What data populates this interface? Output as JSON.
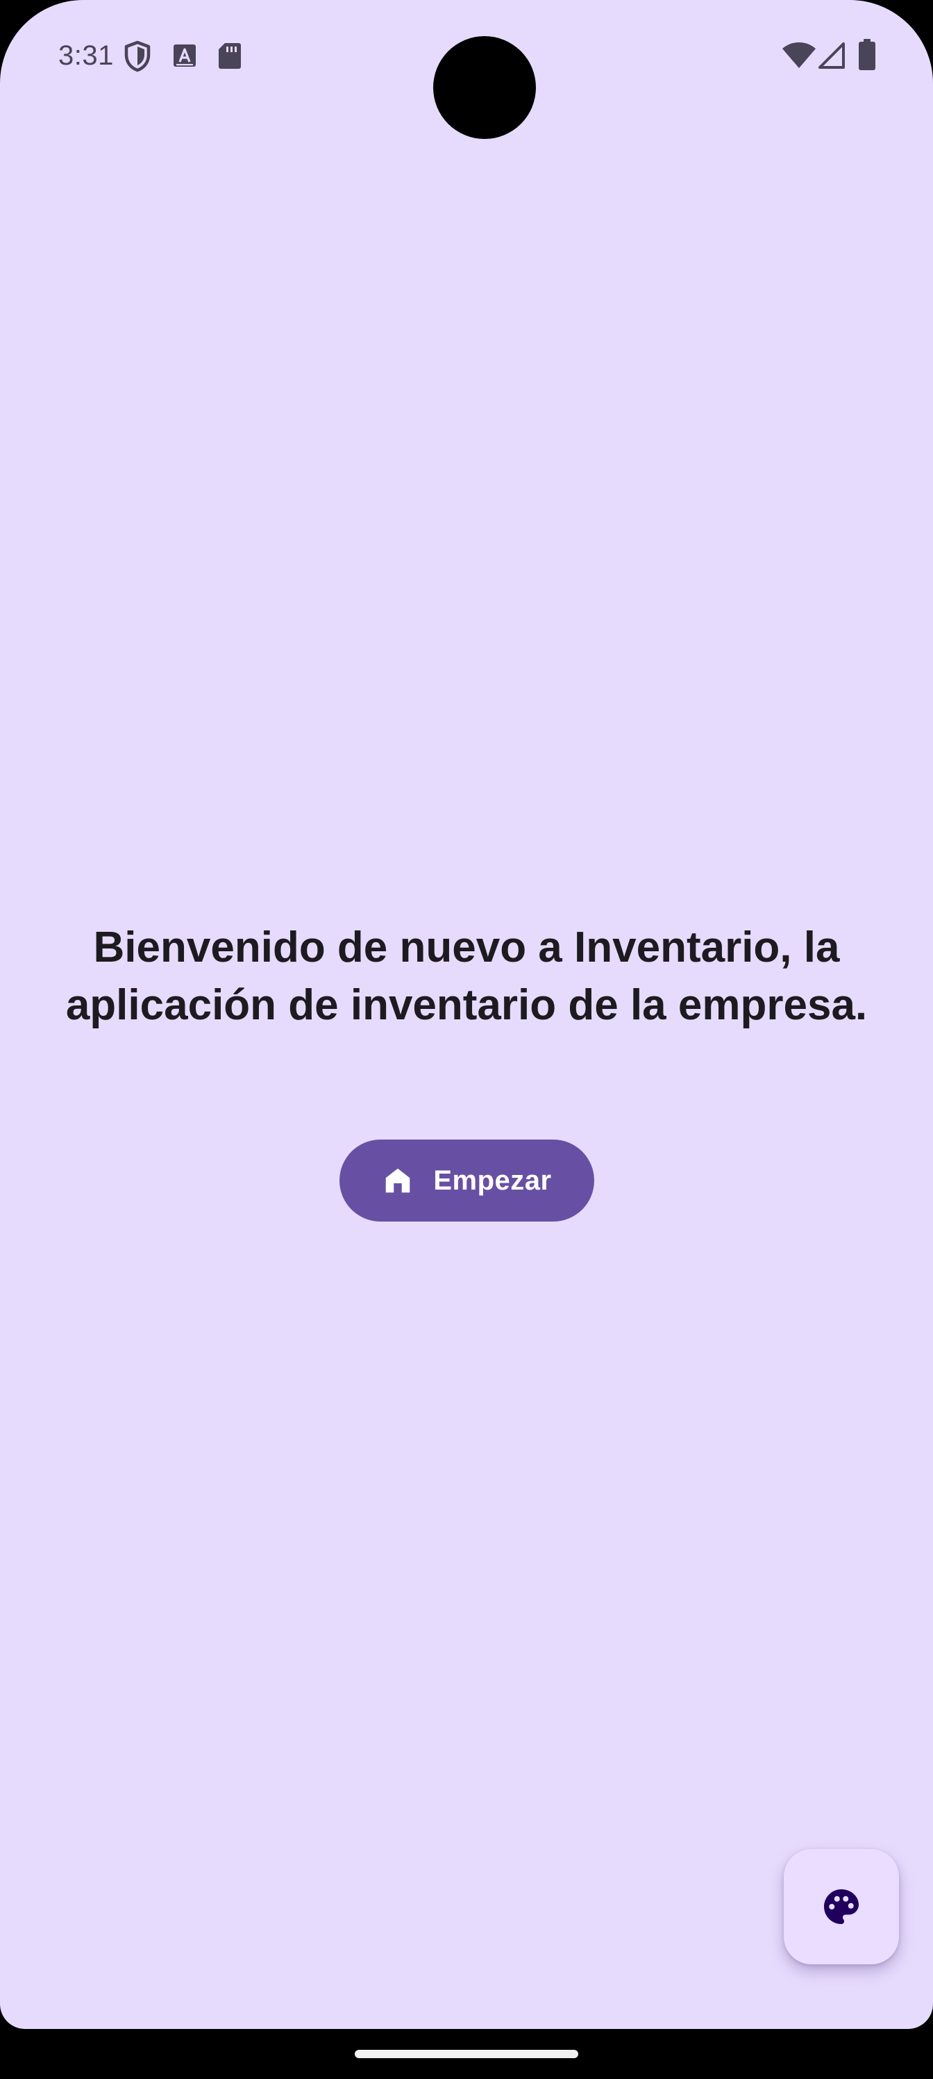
{
  "status_bar": {
    "time": "3:31",
    "left_icons": [
      "shield-icon",
      "font-a-icon",
      "sd-card-icon"
    ],
    "right_icons": [
      "wifi-icon",
      "cell-signal-icon",
      "battery-icon"
    ]
  },
  "main": {
    "welcome_text": "Bienvenido de nuevo a Inventario, la aplicación de inventario de la empresa.",
    "start_button": {
      "label": "Empezar",
      "icon": "home-icon"
    }
  },
  "fab": {
    "icon": "palette-icon"
  },
  "colors": {
    "background": "#E7DBFD",
    "primary": "#6750A4",
    "on_primary": "#FFFFFF",
    "fab_container": "#EADDFF",
    "fab_icon": "#21005D",
    "text": "#1D1B20"
  }
}
